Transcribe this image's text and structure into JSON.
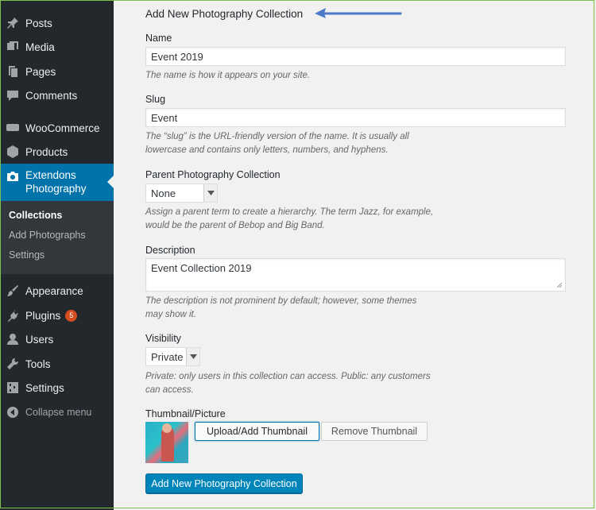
{
  "sidebar": {
    "items": [
      {
        "label": "Posts",
        "icon": "pin-icon"
      },
      {
        "label": "Media",
        "icon": "media-icon"
      },
      {
        "label": "Pages",
        "icon": "pages-icon"
      },
      {
        "label": "Comments",
        "icon": "comment-icon"
      },
      {
        "label": "WooCommerce",
        "icon": "woocommerce-icon"
      },
      {
        "label": "Products",
        "icon": "box-icon"
      },
      {
        "label_line1": "Extendons",
        "label_line2": "Photography",
        "icon": "camera-icon"
      }
    ],
    "submenu": [
      "Collections",
      "Add Photographs",
      "Settings"
    ],
    "bottom_items": [
      {
        "label": "Appearance",
        "icon": "brush-icon"
      },
      {
        "label": "Plugins",
        "icon": "plug-icon",
        "badge": "5"
      },
      {
        "label": "Users",
        "icon": "user-icon"
      },
      {
        "label": "Tools",
        "icon": "wrench-icon"
      },
      {
        "label": "Settings",
        "icon": "settings-icon"
      },
      {
        "label": "Collapse menu",
        "icon": "collapse-icon"
      }
    ]
  },
  "form": {
    "title": "Add New Photography Collection",
    "name_label": "Name",
    "name_value": "Event 2019",
    "name_desc": "The name is how it appears on your site.",
    "slug_label": "Slug",
    "slug_value": "Event",
    "slug_desc_1": "The “slug” is the URL-friendly version of the name. It is usually all",
    "slug_desc_2": "lowercase and contains only letters, numbers, and hyphens.",
    "parent_label": "Parent Photography Collection",
    "parent_value": "None",
    "parent_desc_1": "Assign a parent term to create a hierarchy. The term Jazz, for example,",
    "parent_desc_2": "would be the parent of Bebop and Big Band.",
    "description_label": "Description",
    "description_value": "Event Collection 2019",
    "description_desc_1": "The description is not prominent by default; however, some themes",
    "description_desc_2": "may show it.",
    "visibility_label": "Visibility",
    "visibility_value": "Private",
    "visibility_desc_1": "Private: only users in this collection can access. Public: any customers",
    "visibility_desc_2": "can access.",
    "thumbnail_label": "Thumbnail/Picture",
    "upload_button": "Upload/Add Thumbnail",
    "remove_button": "Remove Thumbnail",
    "submit_button": "Add New Photography Collection"
  },
  "colors": {
    "sidebar_bg": "#23282d",
    "active_bg": "#0073aa",
    "primary_button": "#0085ba",
    "annotation_arrow": "#4a7ac8"
  }
}
